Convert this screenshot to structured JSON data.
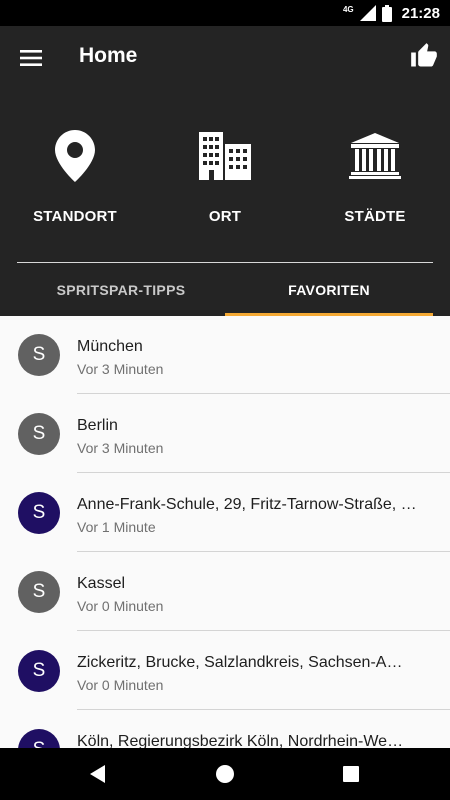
{
  "status_bar": {
    "network": "4G",
    "time": "21:28"
  },
  "app_bar": {
    "title": "Home"
  },
  "categories": [
    {
      "label": "STANDORT",
      "icon": "location-pin-icon"
    },
    {
      "label": "ORT",
      "icon": "buildings-icon"
    },
    {
      "label": "STÄDTE",
      "icon": "landmark-icon"
    }
  ],
  "tabs": [
    {
      "label": "SPRITSPAR-TIPPS",
      "active": false
    },
    {
      "label": "FAVORITEN",
      "active": true
    }
  ],
  "colors": {
    "accent": "#f4a934",
    "avatar_gray": "#616161",
    "avatar_purple": "#1f0f63",
    "background": "#242424"
  },
  "favorites": [
    {
      "avatar": "S",
      "title": "München",
      "time": "Vor 3 Minuten",
      "avatar_color": "#616161"
    },
    {
      "avatar": "S",
      "title": "Berlin",
      "time": "Vor 3 Minuten",
      "avatar_color": "#616161"
    },
    {
      "avatar": "S",
      "title": "Anne-Frank-Schule, 29, Fritz-Tarnow-Straße, …",
      "time": "Vor 1 Minute",
      "avatar_color": "#1f0f63"
    },
    {
      "avatar": "S",
      "title": "Kassel",
      "time": "Vor 0 Minuten",
      "avatar_color": "#616161"
    },
    {
      "avatar": "S",
      "title": "Zickeritz, Brucke, Salzlandkreis, Sachsen-A…",
      "time": "Vor 0 Minuten",
      "avatar_color": "#1f0f63"
    },
    {
      "avatar": "S",
      "title": "Köln, Regierungsbezirk Köln, Nordrhein-We…",
      "time": "",
      "avatar_color": "#1f0f63"
    }
  ]
}
